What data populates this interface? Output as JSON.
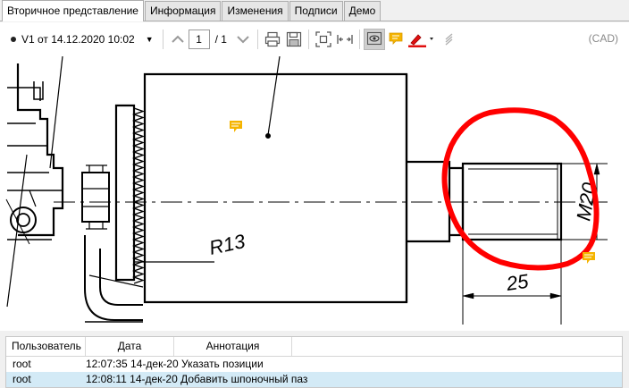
{
  "tabs": [
    {
      "label": "Вторичное представление",
      "active": true
    },
    {
      "label": "Информация",
      "active": false
    },
    {
      "label": "Изменения",
      "active": false
    },
    {
      "label": "Подписи",
      "active": false
    },
    {
      "label": "Демо",
      "active": false
    }
  ],
  "toolbar": {
    "version_label": "V1 от 14.12.2020 10:02",
    "page_value": "1",
    "page_total": "/ 1",
    "mode_label": "(CAD)",
    "icons": [
      "chevron-up-icon",
      "chevron-down-icon",
      "print-icon",
      "save-icon",
      "fit-page-icon",
      "fit-width-icon",
      "view-annotations-icon",
      "comment-icon",
      "pen-color-icon",
      "signature-icon"
    ],
    "pen_color": "#e01010"
  },
  "drawing": {
    "radius_label": "R13",
    "thread_label": "M20",
    "dimension_label": "25",
    "markup_color": "#ff0000",
    "comment_color": "#f5b400"
  },
  "annotations": {
    "columns": [
      "Пользователь",
      "Дата",
      "Аннотация"
    ],
    "rows": [
      {
        "user": "root",
        "date": "12:07:35 14-дек-20",
        "text": "Указать позиции",
        "selected": false
      },
      {
        "user": "root",
        "date": "12:08:11 14-дек-20",
        "text": "Добавить шпоночный паз",
        "selected": true
      }
    ]
  }
}
